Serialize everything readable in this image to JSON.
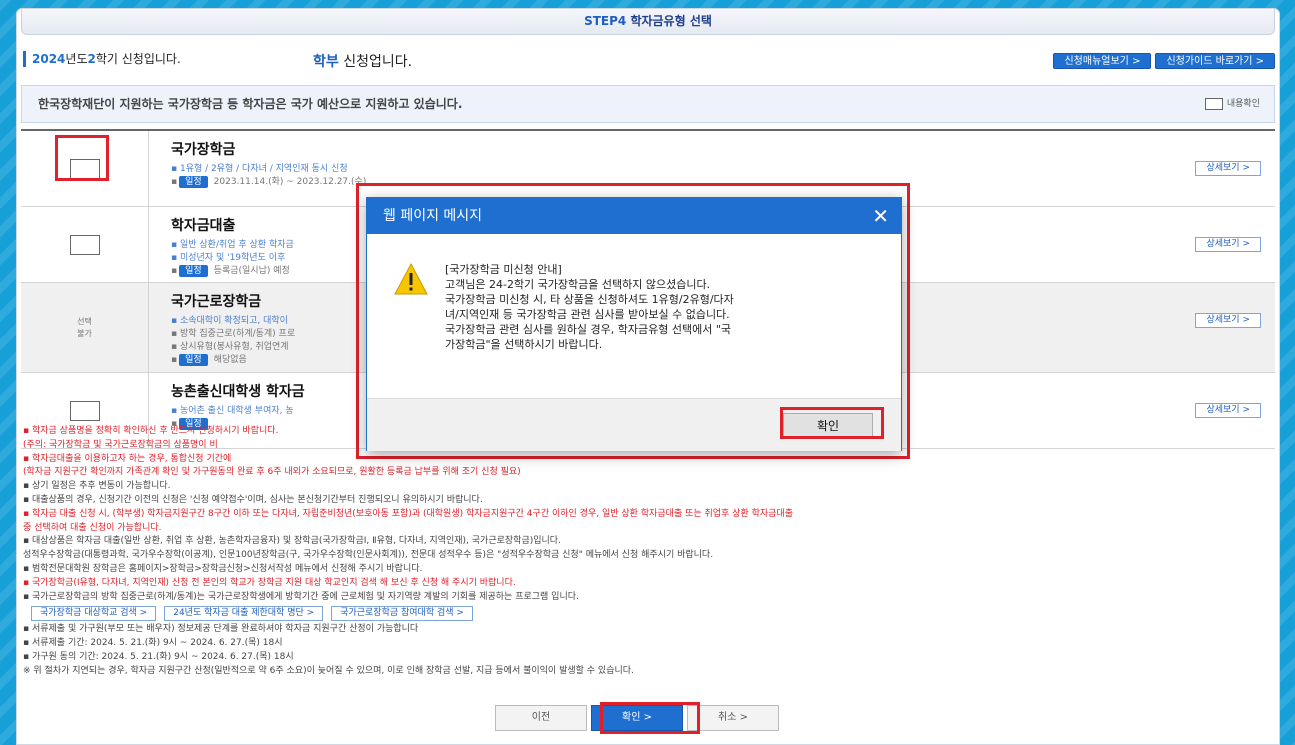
{
  "step": {
    "prefix": "STEP4",
    "title": "학자금유형 선택"
  },
  "header": {
    "semester_year": "2024",
    "semester_mid": "년도",
    "semester_num": "2",
    "semester_suffix": "학기 신청입니다.",
    "apply_type_hl": "학부",
    "apply_type_suffix": " 신청업니다."
  },
  "top_buttons": {
    "manual": "신청매뉴얼보기 >",
    "guide": "신청가이드 바로가기 >"
  },
  "notice": {
    "text": "한국장학재단이 지원하는 국가장학금 등 학자금은 국가 예산으로 지원하고 있습니다.",
    "confirm_label": "내용확인"
  },
  "rows": [
    {
      "title": "국가장학금",
      "lines": [
        "1유형 / 2유형 / 다자녀 / 지역인재 동시 신청"
      ],
      "tag": "일정",
      "tag_text": "2023.11.14.(화) ~ 2023.12.27.(수)",
      "detail": "상세보기 >"
    },
    {
      "title": "학자금대출",
      "lines": [
        "일반 상환/취업 후 상환 학자금",
        "미성년자 및 '19학년도 이후"
      ],
      "tag": "일정",
      "tag_text": "등록금(일시납) 예정",
      "detail": "상세보기 >"
    },
    {
      "title": "국가근로장학금",
      "select_na": "선택\n불가",
      "lines": [
        "소속대학이 확정되고, 대학이",
        "방학 집중근로(하계/동계) 프로",
        "상시유형(봉사유형, 취업연계"
      ],
      "tag": "일정",
      "tag_text": "해당없음",
      "detail": "상세보기 >"
    },
    {
      "title": "농촌출신대학생 학자금",
      "lines": [
        "농어촌 출신 대학생 부여자, 농"
      ],
      "tag": "일정",
      "tag_text": "",
      "detail": "상세보기 >"
    }
  ],
  "notes": {
    "n1": "▪ 학자금 상품명을 정확히 확인하신 후 반드시 신청하시기 바랍니다.",
    "n2": "(주의: 국가장학금 및 국가근로장학금의 상품명이 비",
    "n3": "▪ 학자금대출을 이용하고자 하는 경우, 통합신청 기간에",
    "n4": "(학자금 지원구간 확인까지 가족관계 확인 및 가구원동의 완료 후 6주 내외가 소요되므로, 원활한 등록금 납부를 위해 조기 신청 필요)",
    "n5": "▪ 상기 일정은 추후 변동이 가능합니다.",
    "n6": "▪ 대출상품의 경우, 신청기간 이전의 신청은 '신청 예약접수'이며, 심사는 본신청기간부터 진행되오니 유의하시기 바랍니다.",
    "n7": "▪ 학자금 대출 신청 시, (학부생) 학자금지원구간 8구간 이하 또는 다자녀, 자립준비청년(보호아동 포함)과 (대학원생) 학자금지원구간 4구간 이하인 경우, 일반 상환 학자금대출 또는 취업후 상환 학자금대출",
    "n8": "중 선택하여 대출 신청이 가능합니다.",
    "n9": "▪ 대상상품은 학자금 대출(일반 상환, 취업 후 상환, 농촌학자금융자) 및 장학금(국가장학금Ⅰ, Ⅱ유형, 다자녀, 지역인재), 국가근로장학금)입니다.",
    "n10": "성적우수장학금(대통령과학, 국가우수장학(이공계), 인문100년장학금(구, 국가우수장학(인문사회계)), 전문대 성적우수 등)은 \"성적우수장학금 신청\" 메뉴에서 신청 해주시기 바랍니다.",
    "n11": "▪ 범학전문대학원 장학금은 홈페이지>장학금>장학금신청>신청서작성 메뉴에서 신청해 주시기 바랍니다.",
    "n12": "▪ 국가장학금(Ⅰ유형, 다자녀, 지역인재) 신청 전 본인의 학교가 장학금 지원 대상 학교인지 검색 해 보신 후 신청 해 주시기 바랍니다.",
    "n13": "▪ 국가근로장학금의 방학 집중근로(하계/동계)는 국가근로장학생에게 방학기간 중에 근로체험 및 자기역량 계발의 기회를 제공하는 프로그램 입니다.",
    "n14": "▪ 서류제출 및 가구원(부모 또는 배우자) 정보제공 단계를 완료하셔야 학자금 지원구간 산정이 가능합니다",
    "n15": "▪ 서류제출 기간: 2024. 5. 21.(화) 9시 ~ 2024. 6. 27.(목) 18시",
    "n16": "▪ 가구원 동의 기간: 2024. 5. 21.(화) 9시 ~ 2024. 6. 27.(목) 18시",
    "n17": "※ 위 절차가 지연되는 경우, 학자금 지원구간 산정(일반적으로 약 6주 소요)이 늦어질 수 있으며, 이로 인해 장학금 선발, 지급 등에서 불이익이 발생할 수 있습니다."
  },
  "links": {
    "l1": "국가장학금 대상학교 검색 >",
    "l2": "24년도 학자금 대출 제한대학 명단 >",
    "l3": "국가근로장학금 참여대학 검색 >"
  },
  "bottom_buttons": {
    "prev": "이전",
    "confirm": "확인 >",
    "cancel": "취소 >"
  },
  "dialog": {
    "title": "웹 페이지 메시지",
    "close": "✕",
    "message_lines": [
      "[국가장학금 미신청 안내]",
      "고객님은 24-2학기 국가장학금을 선택하지 않으셨습니다.",
      "국가장학금 미신청 시, 타 상품을 신청하셔도 1유형/2유형/다자",
      "녀/지역인재 등 국가장학금 관련 심사를 받아보실 수 없습니다.",
      "국가장학금 관련 심사를 원하실 경우, 학자금유형 선택에서 \"국",
      "가장학금\"을 선택하시기 바랍니다."
    ],
    "ok": "확인"
  },
  "colors": {
    "primary": "#1f6fd1",
    "highlight_red": "#e0202a",
    "frame": "#17a0d8"
  }
}
